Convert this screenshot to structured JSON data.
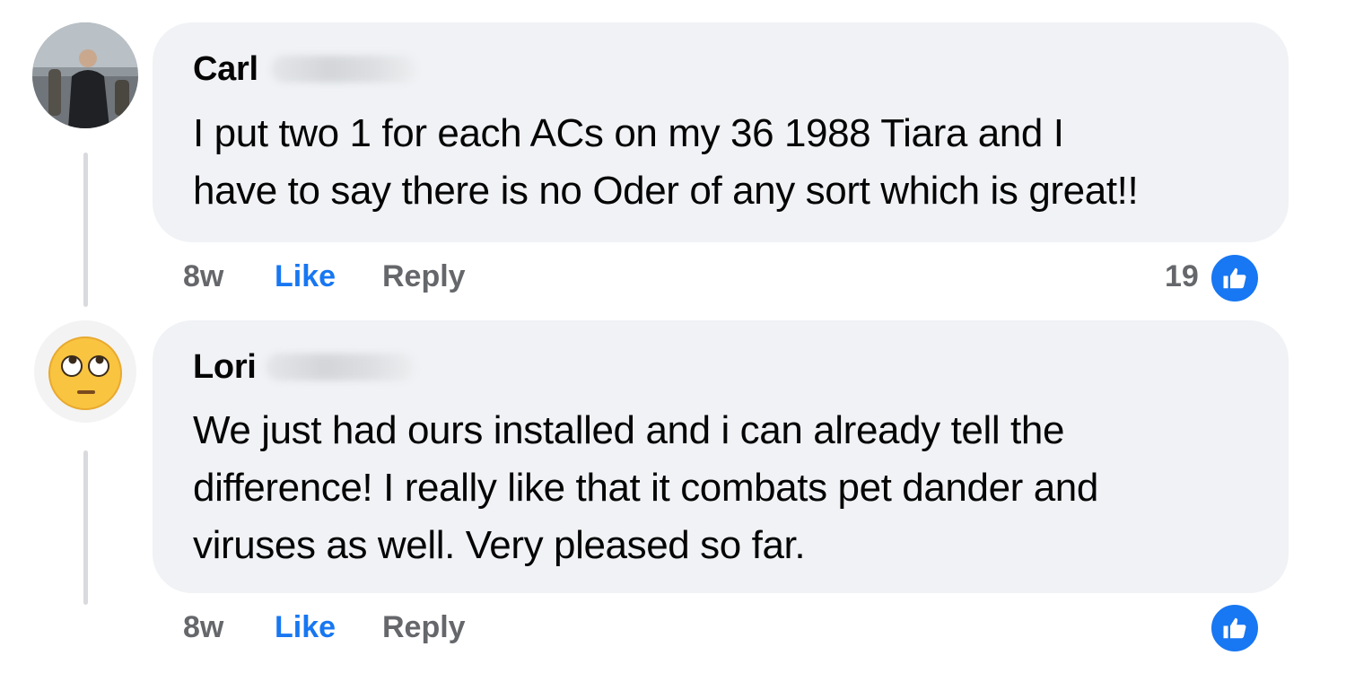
{
  "comments": [
    {
      "author": "Carl",
      "text_lines": [
        "I put two 1 for each ACs on my 36 1988 Tiara and I",
        "have to say there is no Oder of any sort which is great!!"
      ],
      "time": "8w",
      "like_label": "Like",
      "reply_label": "Reply",
      "reaction_count": "19",
      "avatar_icon": "profile-photo",
      "reaction_icon": "thumbs-up-icon"
    },
    {
      "author": "Lori",
      "text_lines": [
        "We just had ours installed and i can already tell the",
        "difference! I really like that it combats pet dander and",
        "viruses as well. Very pleased so far."
      ],
      "time": "8w",
      "like_label": "Like",
      "reply_label": "Reply",
      "avatar_icon": "eye-roll-emoji-icon",
      "reaction_icon": "thumbs-up-icon"
    }
  ],
  "colors": {
    "bubble": "#f0f2f5",
    "link_blue": "#1877f2",
    "meta_gray": "#65676b",
    "text": "#050505"
  }
}
